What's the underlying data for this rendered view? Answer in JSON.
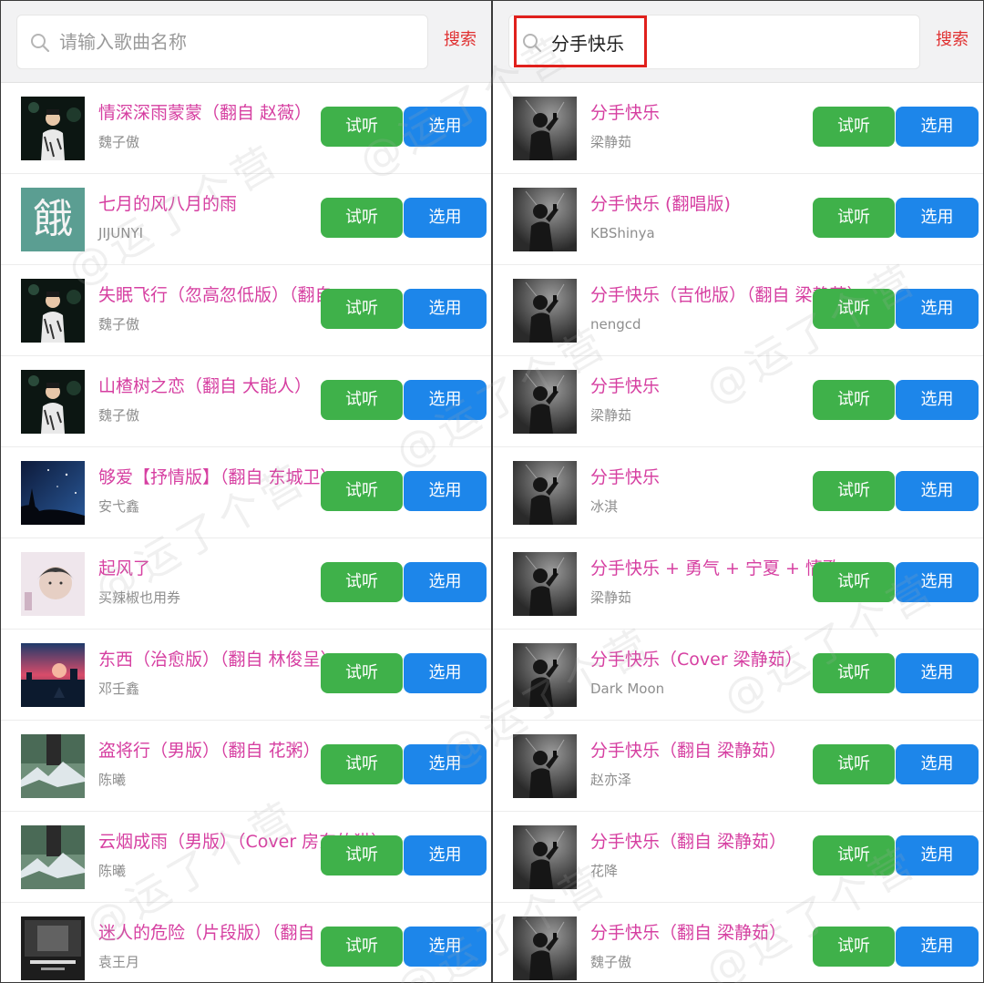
{
  "left_panel": {
    "search": {
      "placeholder": "请输入歌曲名称",
      "value": "",
      "button_label": "搜索"
    },
    "songs": [
      {
        "title": "情深深雨蒙蒙（翻自 赵薇）",
        "artist": "魏子傲",
        "cover": "person-night"
      },
      {
        "title": "七月的风八月的雨",
        "artist": "JIJUNYI",
        "cover": "char",
        "cover_char": "餓"
      },
      {
        "title": "失眠飞行（忽高忽低版）（翻自",
        "artist": "魏子傲",
        "cover": "person-night"
      },
      {
        "title": "山楂树之恋（翻自 大能人）",
        "artist": "魏子傲",
        "cover": "person-night"
      },
      {
        "title": "够爱【抒情版】（翻自 东城卫）",
        "artist": "安弋鑫",
        "cover": "starry-sky"
      },
      {
        "title": "起风了",
        "artist": "买辣椒也用券",
        "cover": "portrait-light"
      },
      {
        "title": "东西（治愈版）（翻自 林俊呈）",
        "artist": "邓壬鑫",
        "cover": "sunset-city"
      },
      {
        "title": "盗将行（男版）（翻自 花粥）",
        "artist": "陈曦",
        "cover": "mountain"
      },
      {
        "title": "云烟成雨（男版）（Cover 房东的猫）",
        "artist": "陈曦",
        "cover": "mountain"
      },
      {
        "title": "迷人的危险（片段版）（翻自",
        "artist": "袁王月",
        "cover": "dark-poster"
      }
    ]
  },
  "right_panel": {
    "search": {
      "placeholder": "请输入歌曲名称",
      "value": "分手快乐",
      "button_label": "搜索"
    },
    "songs": [
      {
        "title": "分手快乐",
        "artist": "梁静茹",
        "cover": "singer-silhouette"
      },
      {
        "title": "分手快乐 (翻唱版)",
        "artist": "KBShinya",
        "cover": "singer-silhouette"
      },
      {
        "title": "分手快乐（吉他版）（翻自 梁静茹）",
        "artist": "nengcd",
        "cover": "singer-silhouette"
      },
      {
        "title": "分手快乐",
        "artist": "梁静茹",
        "cover": "singer-silhouette"
      },
      {
        "title": "分手快乐",
        "artist": "冰淇",
        "cover": "singer-silhouette"
      },
      {
        "title": "分手快乐 + 勇气 + 宁夏 + 情歌",
        "artist": "梁静茹",
        "cover": "singer-silhouette"
      },
      {
        "title": "分手快乐（Cover 梁静茹）",
        "artist": "Dark Moon",
        "cover": "singer-silhouette"
      },
      {
        "title": "分手快乐（翻自 梁静茹）",
        "artist": "赵亦泽",
        "cover": "singer-silhouette"
      },
      {
        "title": "分手快乐（翻自 梁静茹）",
        "artist": "花降",
        "cover": "singer-silhouette"
      },
      {
        "title": "分手快乐（翻自 梁静茹）",
        "artist": "魏子傲",
        "cover": "singer-silhouette"
      }
    ]
  },
  "buttons": {
    "listen_label": "试听",
    "select_label": "选用"
  },
  "watermark_text": "@运了个营",
  "colors": {
    "title": "#d63fa1",
    "listen_button": "#3fb14a",
    "select_button": "#1d86ea",
    "search_button": "#e03131",
    "highlight_box": "#e0201c"
  }
}
